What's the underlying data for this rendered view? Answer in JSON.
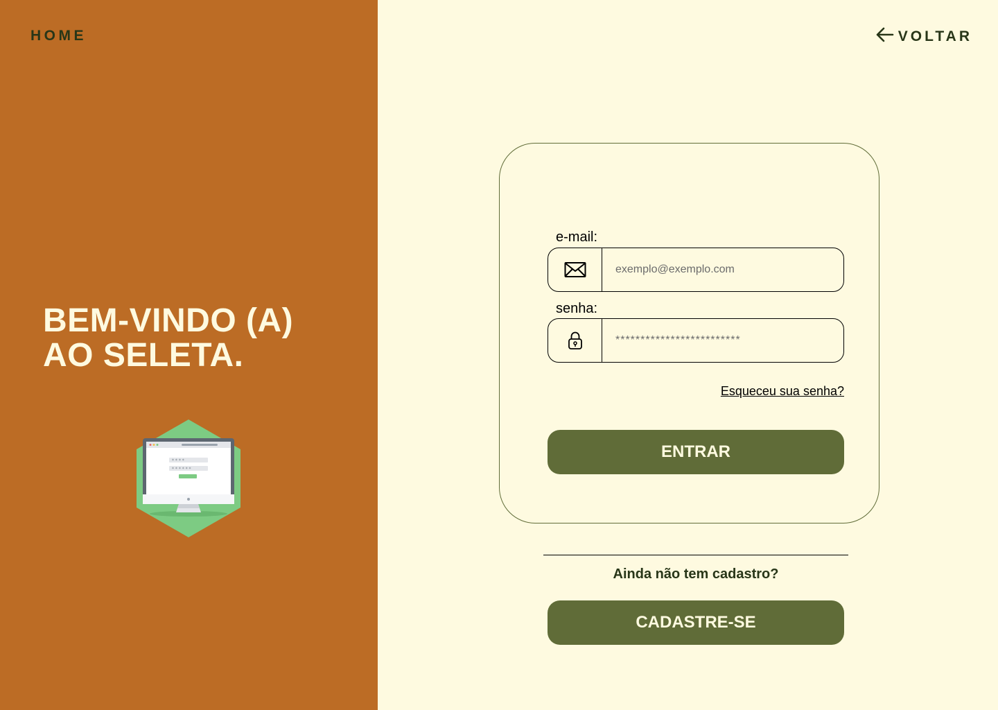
{
  "nav": {
    "home_label": "HOME",
    "back_label": "VOLTAR"
  },
  "welcome": {
    "line1": "BEM-VINDO (A)",
    "line2": "AO SELETA."
  },
  "form": {
    "email_label": "e-mail:",
    "email_placeholder": "exemplo@exemplo.com",
    "password_label": "senha:",
    "password_placeholder": "*************************",
    "forgot_label": "Esqueceu sua senha?",
    "submit_label": "ENTRAR"
  },
  "signup": {
    "prompt": "Ainda não tem cadastro?",
    "button_label": "CADASTRE-SE"
  },
  "icons": {
    "back": "arrow-left-icon",
    "email": "envelope-icon",
    "password": "lock-icon",
    "illustration": "computer-login-icon"
  },
  "colors": {
    "left_background": "#BC6C25",
    "right_background": "#FEFAE0",
    "primary_button": "#606C38",
    "dark_text": "#283618",
    "illustration_badge": "#7DCB83"
  }
}
